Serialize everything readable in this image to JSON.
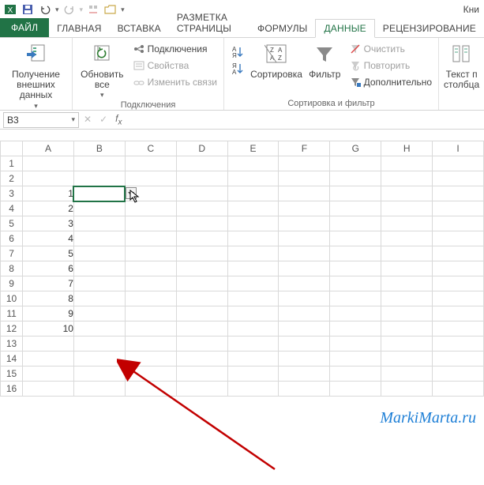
{
  "title": "Кни",
  "tabs": {
    "file": "ФАЙЛ",
    "items": [
      "ГЛАВНАЯ",
      "ВСТАВКА",
      "РАЗМЕТКА СТРАНИЦЫ",
      "ФОРМУЛЫ",
      "ДАННЫЕ",
      "РЕЦЕНЗИРОВАНИЕ"
    ],
    "active": "ДАННЫЕ"
  },
  "ribbon": {
    "ext_data": {
      "get": "Получение\nвнешних данных",
      "label": ""
    },
    "connections": {
      "refresh": "Обновить\nвсе",
      "conn": "Подключения",
      "props": "Свойства",
      "edit": "Изменить связи",
      "label": "Подключения"
    },
    "sort": {
      "sortbtn": "Сортировка",
      "filter": "Фильтр",
      "clear": "Очистить",
      "reapply": "Повторить",
      "advanced": "Дополнительно",
      "label": "Сортировка и фильтр"
    },
    "text": {
      "t2c": "Текст п\nстолбца"
    }
  },
  "namebox": "B3",
  "columns": [
    "A",
    "B",
    "C",
    "D",
    "E",
    "F",
    "G",
    "H",
    "I"
  ],
  "rows": [
    "1",
    "2",
    "3",
    "4",
    "5",
    "6",
    "7",
    "8",
    "9",
    "10",
    "11",
    "12",
    "13",
    "14",
    "15",
    "16"
  ],
  "cells": {
    "A3": "1",
    "A4": "2",
    "A5": "3",
    "A6": "4",
    "A7": "5",
    "A8": "6",
    "A9": "7",
    "A10": "8",
    "A11": "9",
    "A12": "10"
  },
  "selected": {
    "col": "B",
    "row": "3"
  },
  "watermark": "MarkiMarta.ru"
}
